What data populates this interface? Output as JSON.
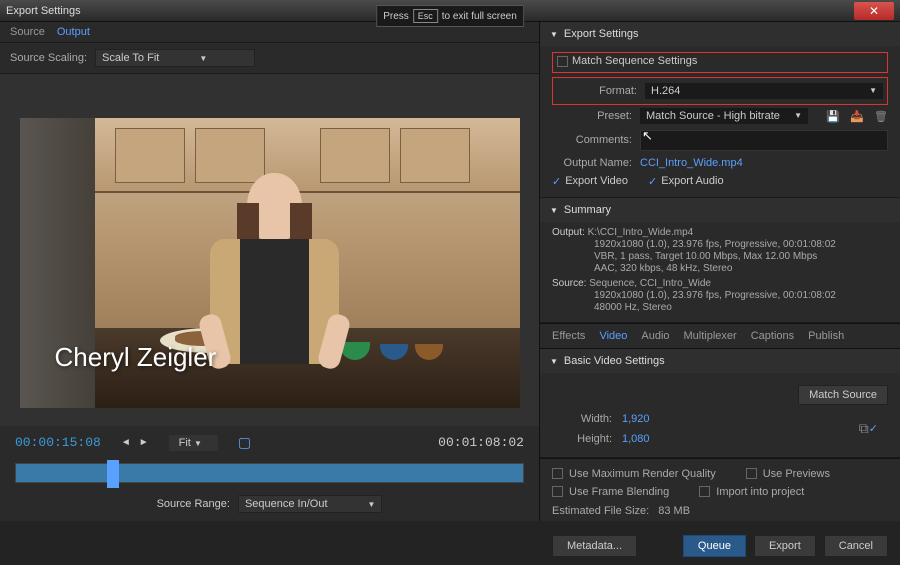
{
  "window_title": "Export Settings",
  "esc_hint_pre": "Press",
  "esc_key": "Esc",
  "esc_hint_post": "to exit full screen",
  "left_tabs": {
    "source": "Source",
    "output": "Output"
  },
  "scaling": {
    "label": "Source Scaling:",
    "value": "Scale To Fit"
  },
  "preview_name": "Cheryl Zeigler",
  "transport": {
    "current_tc": "00:00:15:08",
    "total_tc": "00:01:08:02",
    "fit": "Fit"
  },
  "source_range": {
    "label": "Source Range:",
    "value": "Sequence In/Out"
  },
  "export_settings": {
    "header": "Export Settings",
    "match_seq": "Match Sequence Settings",
    "format_label": "Format:",
    "format_value": "H.264",
    "preset_label": "Preset:",
    "preset_value": "Match Source - High bitrate",
    "comments_label": "Comments:",
    "output_name_label": "Output Name:",
    "output_name_value": "CCI_Intro_Wide.mp4",
    "export_video": "Export Video",
    "export_audio": "Export Audio"
  },
  "summary": {
    "header": "Summary",
    "output_label": "Output:",
    "output_path": "K:\\CCI_Intro_Wide.mp4",
    "output_l1": "1920x1080 (1.0), 23.976 fps, Progressive, 00:01:08:02",
    "output_l2": "VBR, 1 pass, Target 10.00 Mbps, Max 12.00 Mbps",
    "output_l3": "AAC, 320 kbps, 48 kHz, Stereo",
    "source_label": "Source:",
    "source_l1": "Sequence, CCI_Intro_Wide",
    "source_l2": "1920x1080 (1.0), 23.976 fps, Progressive, 00:01:08:02",
    "source_l3": "48000 Hz, Stereo"
  },
  "sub_tabs": {
    "effects": "Effects",
    "video": "Video",
    "audio": "Audio",
    "multiplexer": "Multiplexer",
    "captions": "Captions",
    "publish": "Publish"
  },
  "bvs": {
    "header": "Basic Video Settings",
    "match_source": "Match Source",
    "width_label": "Width:",
    "width_value": "1,920",
    "height_label": "Height:",
    "height_value": "1,080"
  },
  "bottom_cb": {
    "max_quality": "Use Maximum Render Quality",
    "previews": "Use Previews",
    "frame_blend": "Use Frame Blending",
    "import_proj": "Import into project"
  },
  "est_label": "Estimated File Size:",
  "est_value": "83 MB",
  "buttons": {
    "metadata": "Metadata...",
    "queue": "Queue",
    "export": "Export",
    "cancel": "Cancel"
  }
}
